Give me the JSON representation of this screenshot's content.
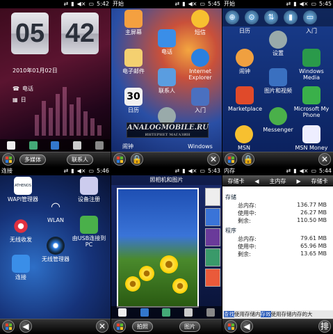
{
  "panels": {
    "home": {
      "status_time": "5:42",
      "clock_hour": "05",
      "clock_minute": "42",
      "date": "2010年01月02日",
      "row_phone": "电话",
      "row_calendar": "日",
      "softkey_left": "多媒体",
      "softkey_right": "联系人"
    },
    "start1": {
      "title": "开始",
      "status_time": "5:45",
      "tiles": [
        "主屏幕",
        "短信",
        "电话",
        "电子邮件",
        "Internet Explorer",
        "日历",
        "联系人",
        "入门",
        "闹钟",
        "Windows"
      ],
      "calendar_day": "30",
      "watermark": "ANALOGMOBILE.RU",
      "watermark_sub": "ИНТЕРНЕТ МАГАЗИН"
    },
    "start2": {
      "title": "开始",
      "status_time": "5:45",
      "tiles": [
        "日历",
        "入门",
        "闹钟",
        "设置",
        "Windows Media",
        "图片和视频",
        "Marketplace",
        "Microsoft My Phone",
        "Messenger",
        "MSN Weather",
        "MSN Money"
      ]
    },
    "connect": {
      "title": "连接",
      "status_time": "5:46",
      "items": [
        "WAPI管理器",
        "设备注册",
        "WLAN",
        "无线收发",
        "由USB连接到PC",
        "无线管理器",
        "连接"
      ],
      "athenos": "ATHENOS"
    },
    "photos": {
      "status_time": "5:43",
      "title": "照相机和图片",
      "softkey_left": "拍照",
      "softkey_right": "图片"
    },
    "memory": {
      "title": "内存",
      "status_time": "5:44",
      "tab_left": "存储卡",
      "tab_center": "主内存",
      "tab_right": "存储卡",
      "storage_label": "存储",
      "storage": [
        {
          "k": "总内存:",
          "v": "136.77 MB"
        },
        {
          "k": "使用中:",
          "v": "26.27 MB"
        },
        {
          "k": "剩余:",
          "v": "110.50 MB"
        }
      ],
      "program_label": "程序",
      "program": [
        {
          "k": "总内存:",
          "v": "79.61 MB"
        },
        {
          "k": "使用中:",
          "v": "65.96 MB"
        },
        {
          "k": "剩余:",
          "v": "13.65 MB"
        }
      ],
      "footer_hl1": "查找",
      "footer_text1": "使用存储内",
      "footer_hl2": "存效",
      "footer_text2": "使用存储内存的大",
      "softkey": "排"
    }
  },
  "colors": {
    "win_red": "#e8412a",
    "win_green": "#5cb82a",
    "win_blue": "#2a7be0",
    "win_yellow": "#f5c12a"
  }
}
